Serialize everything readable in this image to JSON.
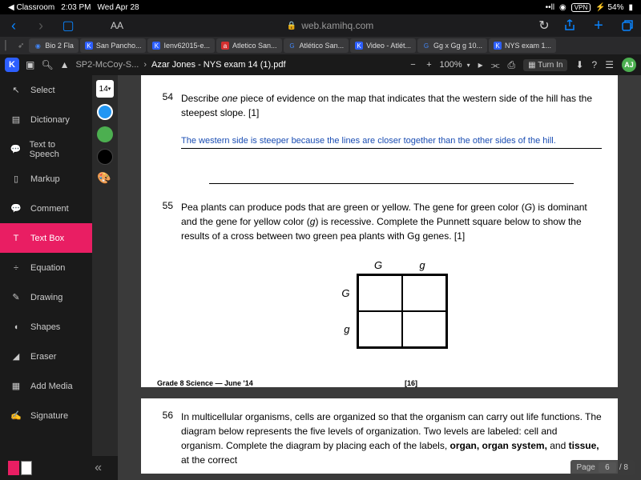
{
  "status": {
    "app": "Classroom",
    "time": "2:03 PM",
    "date": "Wed Apr 28",
    "vpn": "VPN",
    "battery": "54%"
  },
  "safari": {
    "url": "web.kamihq.com",
    "font_size": "AA"
  },
  "tabs": [
    {
      "icon": "G",
      "label": "Bio 2 Fla"
    },
    {
      "icon": "K",
      "label": "San Pancho..."
    },
    {
      "icon": "K",
      "label": "Ienv62015-e..."
    },
    {
      "icon": "a",
      "label": "Atletico San..."
    },
    {
      "icon": "G",
      "label": "Atlético San..."
    },
    {
      "icon": "K",
      "label": "Video - Atlét..."
    },
    {
      "icon": "G",
      "label": "Gg x Gg g 10..."
    },
    {
      "icon": "K",
      "label": "NYS exam 1..."
    }
  ],
  "kami": {
    "logo": "K",
    "breadcrumb1": "SP2-McCoy-S...",
    "breadcrumb2": "Azar Jones - NYS exam 14 (1).pdf",
    "zoom": "100%",
    "turn_in": "Turn In",
    "avatar": "AJ"
  },
  "sidebar": [
    {
      "label": "Select"
    },
    {
      "label": "Dictionary"
    },
    {
      "label": "Text to Speech"
    },
    {
      "label": "Markup"
    },
    {
      "label": "Comment"
    },
    {
      "label": "Text Box",
      "active": true
    },
    {
      "label": "Equation"
    },
    {
      "label": "Drawing"
    },
    {
      "label": "Shapes"
    },
    {
      "label": "Eraser"
    },
    {
      "label": "Add Media"
    },
    {
      "label": "Signature"
    }
  ],
  "size_value": "14",
  "doc": {
    "q54_num": "54",
    "q54_text": "Describe ",
    "q54_italic": "one",
    "q54_text2": " piece of evidence on the map that indicates that the western side of the hill has the steepest slope.   [1]",
    "q54_answer": "The western side is steeper because the lines are closer together than the other sides of the hill.",
    "q55_num": "55",
    "q55_text": "Pea plants can produce pods that are green or yellow. The gene for green color (",
    "q55_G": "G",
    "q55_text2": ") is dominant and the gene for yellow color (",
    "q55_g": "g",
    "q55_text3": ") is recessive. Complete the Punnett square below to show the results of a cross between two green pea plants with Gg genes.   [1]",
    "punnett_G": "G",
    "punnett_g": "g",
    "footer_left": "Grade 8 Science — June '14",
    "footer_center": "[16]",
    "q56_num": "56",
    "q56_text": "In multicellular organisms, cells are organized so that the organism can carry out life functions. The diagram below represents the five levels of organization. Two levels are labeled: cell and organism. Complete the diagram by placing each of the labels, ",
    "q56_bold1": "organ, organ system,",
    "q56_text2": " and ",
    "q56_bold2": "tissue,",
    "q56_text3": " at the correct"
  },
  "page_nav": {
    "label": "Page",
    "current": "6",
    "total": "/ 8"
  }
}
